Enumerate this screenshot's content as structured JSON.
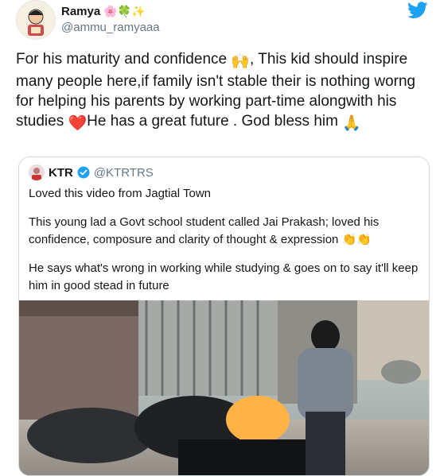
{
  "author": {
    "name": "Ramya",
    "name_emojis": "🌸🍀✨",
    "handle": "@ammu_ramyaaa"
  },
  "tweet": {
    "text_1": "For his maturity and confidence ",
    "emoji_1": "🙌",
    "text_2": ", This kid should inspire many people here,if family isn't stable their is nothing worng for helping his parents by working part-time alongwith his studies ",
    "emoji_2": "❤️",
    "text_3": "He has a great future . God bless him ",
    "emoji_3": "🙏"
  },
  "quoted": {
    "name": "KTR",
    "handle": "@KTRTRS",
    "line_1": "Loved this video from Jagtial Town",
    "line_2a": "This young lad a Govt school student called Jai Prakash; loved his confidence, composure and clarity of thought & expression ",
    "line_2_emoji": "👏👏",
    "line_3": "He says what's wrong in working while studying & goes on to say it'll keep him in good stead in future"
  },
  "icons": {
    "brand": "twitter-bird-icon",
    "verified": "verified-badge-icon"
  },
  "colors": {
    "twitter_blue": "#1da1f2",
    "handle_gray": "#657786",
    "heart_red": "#e0245e"
  }
}
